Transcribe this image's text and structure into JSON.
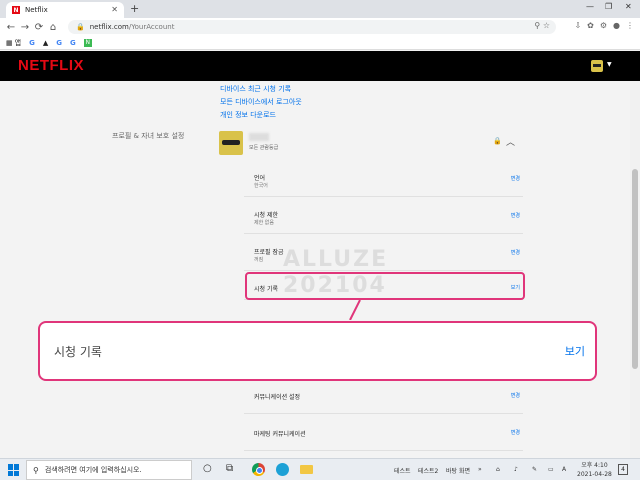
{
  "browser": {
    "tab_title": "Netflix",
    "tab_favicon": "N",
    "url_domain": "netflix.com",
    "url_path": "/YourAccount",
    "bookmarks": [
      {
        "label": "앱"
      },
      {
        "label": "G"
      },
      {
        "label": "G"
      },
      {
        "label": "G"
      }
    ],
    "bookmark_badge": "N"
  },
  "netflix": {
    "logo": "NETFLIX",
    "links": [
      "디바이스 최근 시청 기록",
      "모든 디바이스에서 로그아웃",
      "개인 정보 다운로드"
    ],
    "section_label": "프로필 & 자녀 보호 설정",
    "profile_sub": "모든 관람등급",
    "settings": [
      {
        "title": "언어",
        "sub": "한국어",
        "action": "변경"
      },
      {
        "title": "시청 제한",
        "sub": "제한 없음",
        "action": "변경"
      },
      {
        "title": "프로필 잠금",
        "sub": "꺼짐",
        "action": "변경"
      },
      {
        "title": "시청 기록",
        "sub": "",
        "action": "보기"
      },
      {
        "title": "",
        "sub": "",
        "action": ""
      },
      {
        "title": "커뮤니케이션 설정",
        "sub": "",
        "action": "변경"
      },
      {
        "title": "마케팅 커뮤니케이션",
        "sub": "",
        "action": "변경"
      }
    ],
    "watermark_line1": "ALLUZE",
    "watermark_line2": "202104",
    "callout": {
      "title": "시청 기록",
      "action": "보기"
    }
  },
  "taskbar": {
    "search_placeholder": "검색하려면 여기에 입력하십시오.",
    "tray_items": [
      "테스트",
      "테스트2",
      "바탕 화면"
    ],
    "time": "오후 4:10",
    "date": "2021-04-28",
    "notification_count": "4"
  },
  "colors": {
    "netflix_red": "#e50914",
    "link_blue": "#0071eb",
    "highlight_pink": "#e0357a"
  }
}
